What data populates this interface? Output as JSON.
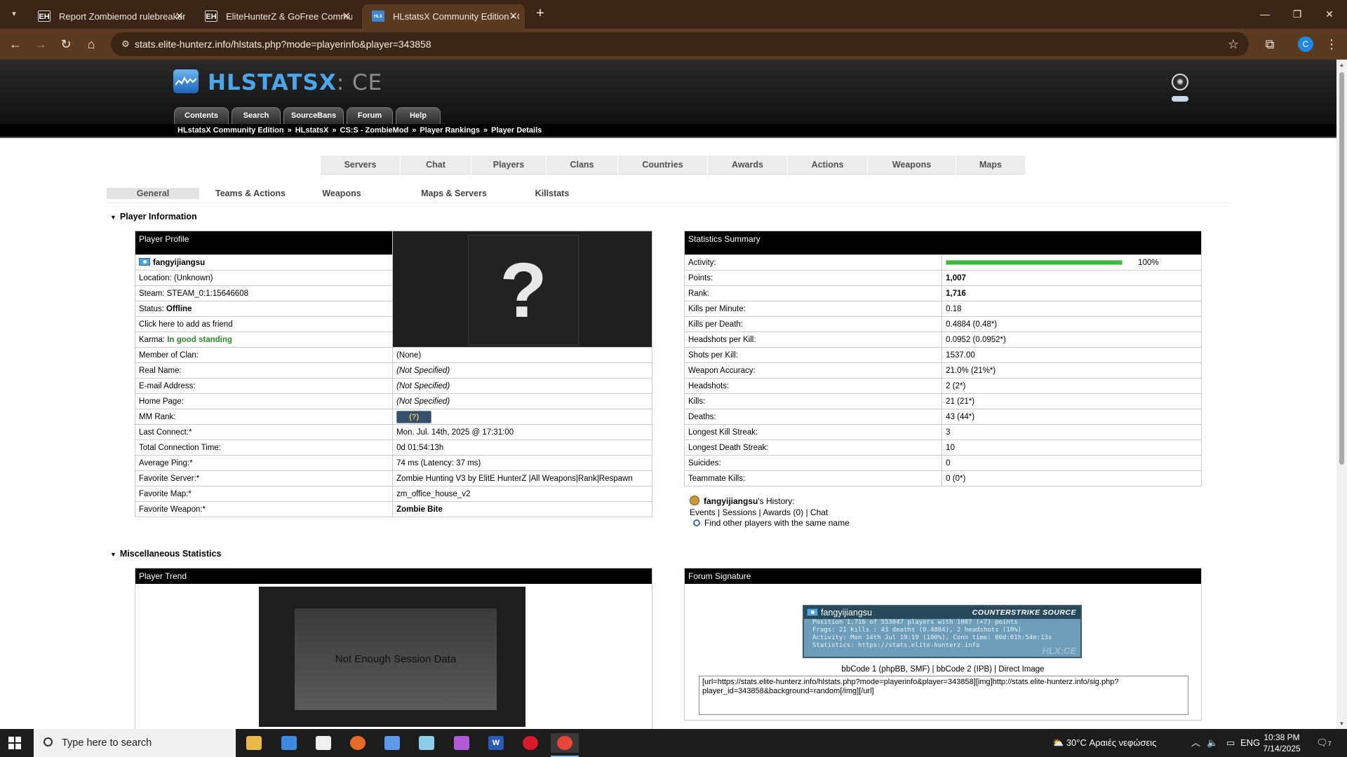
{
  "browser": {
    "tabs": [
      {
        "favicon": "EH",
        "title": "Report Zombiemod rulebreakers",
        "active": false
      },
      {
        "favicon": "EH",
        "title": "EliteHunterZ & GoFree Community",
        "active": false
      },
      {
        "favicon": "HLX",
        "title": "HLstatsX Community Edition - CS:S",
        "active": true
      }
    ],
    "url": "stats.elite-hunterz.info/hlstats.php?mode=playerinfo&player=343858",
    "profile_initial": "C"
  },
  "site": {
    "logo_main": "HLSTATSX",
    "logo_suffix": ": CE",
    "nav_tabs": [
      "Contents",
      "Search",
      "SourceBans",
      "Forum",
      "Help"
    ],
    "breadcrumbs": [
      "HLstatsX Community Edition",
      "HLstatsX",
      "CS:S - ZombieMod",
      "Player Rankings",
      "Player Details"
    ],
    "breadcrumb_sep": "»",
    "menu": [
      "Servers",
      "Chat",
      "Players",
      "Clans",
      "Countries",
      "Awards",
      "Actions",
      "Weapons",
      "Maps"
    ],
    "subtabs": [
      "General",
      "Teams & Actions",
      "Weapons",
      "Maps & Servers",
      "Killstats"
    ]
  },
  "player_information": {
    "section_title": "Player Information",
    "profile_header": "Player Profile",
    "name": "fangyijiangsu",
    "location": "Location: (Unknown)",
    "steam": "Steam: STEAM_0:1:15646608",
    "status_label": "Status:",
    "status_value": "Offline",
    "add_friend": "Click here to add as friend",
    "karma_label": "Karma:",
    "karma_value": "In good standing",
    "avatar_placeholder": "?",
    "rows": [
      {
        "label": "Member of Clan:",
        "value": "(None)"
      },
      {
        "label": "Real Name:",
        "value": "(Not Specified)"
      },
      {
        "label": "E-mail Address:",
        "value": "(Not Specified)"
      },
      {
        "label": "Home Page:",
        "value": "(Not Specified)"
      },
      {
        "label": "MM Rank:",
        "value": "(?)"
      },
      {
        "label": "Last Connect:*",
        "value": "Mon. Jul. 14th, 2025 @ 17:31:00"
      },
      {
        "label": "Total Connection Time:",
        "value": "0d 01:54:13h"
      },
      {
        "label": "Average Ping:*",
        "value": "74 ms (Latency: 37 ms)"
      },
      {
        "label": "Favorite Server:*",
        "value": "Zombie Hunting V3 by ElitE HunterZ |All Weapons|Rank|Respawn"
      },
      {
        "label": "Favorite Map:*",
        "value": "zm_office_house_v2"
      },
      {
        "label": "Favorite Weapon:*",
        "value": "Zombie Bite"
      }
    ]
  },
  "statistics_summary": {
    "header": "Statistics Summary",
    "activity_label": "Activity:",
    "activity_value": "100%",
    "activity_fraction": 1.0,
    "rows": [
      {
        "label": "Points:",
        "value": "1,007",
        "bold": true
      },
      {
        "label": "Rank:",
        "value": "1,716",
        "bold": true
      },
      {
        "label": "Kills per Minute:",
        "value": "0.18"
      },
      {
        "label": "Kills per Death:",
        "value": "0.4884 (0.48*)"
      },
      {
        "label": "Headshots per Kill:",
        "value": "0.0952 (0.0952*)"
      },
      {
        "label": "Shots per Kill:",
        "value": "1537.00"
      },
      {
        "label": "Weapon Accuracy:",
        "value": "21.0% (21%*)"
      },
      {
        "label": "Headshots:",
        "value": "2 (2*)"
      },
      {
        "label": "Kills:",
        "value": "21 (21*)"
      },
      {
        "label": "Deaths:",
        "value": "43 (44*)"
      },
      {
        "label": "Longest Kill Streak:",
        "value": "3"
      },
      {
        "label": "Longest Death Streak:",
        "value": "10"
      },
      {
        "label": "Suicides:",
        "value": "0"
      },
      {
        "label": "Teammate Kills:",
        "value": "0 (0*)"
      }
    ]
  },
  "history": {
    "player": "fangyijiangsu",
    "suffix": "'s History:",
    "links": [
      "Events",
      "Sessions",
      "Awards (0)",
      "Chat"
    ],
    "find_same": "Find other players with the same name"
  },
  "misc": {
    "section_title": "Miscellaneous Statistics",
    "trend_header": "Player Trend",
    "trend_message": "Not Enough Session Data",
    "signature_header": "Forum Signature",
    "sig_name": "fangyijiangsu",
    "sig_game": "COUNTERSTRIKE SOURCE",
    "sig_lines": [
      "Position 1,716 of 553047 players with 1007 (+7) points",
      "Frags: 21 kills : 43 deaths (0.4884), 2 headshots (10%)",
      "Activity: Mon 14th Jul 19:19 (100%), Conn time: 00d:01h:54m:13s",
      "Statistics: https://stats.elite-hunterz.info"
    ],
    "sig_brand": "HLX:CE",
    "bbcode_links": "bbCode 1 (phpBB, SMF) | bbCode 2 (IPB) | Direct Image",
    "bbcode_text": "[url=https://stats.elite-hunterz.info/hlstats.php?mode=playerinfo&player=343858][img]http://stats.elite-hunterz.info/sig.php?player_id=343858&background=random[/img][/url]"
  },
  "taskbar": {
    "search_placeholder": "Type here to search",
    "weather": "30°C  Αραιές νεφώσεις",
    "language": "ENG",
    "time": "10:38 PM",
    "date": "7/14/2025",
    "notification_count": "7"
  }
}
